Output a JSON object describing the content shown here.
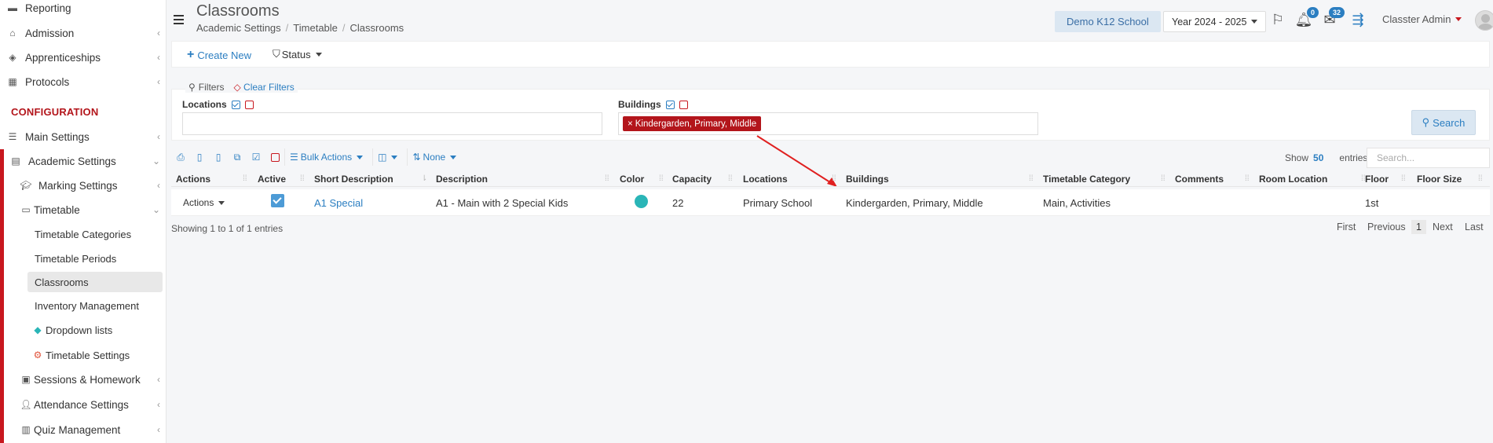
{
  "sidebar": {
    "items": [
      {
        "label": "Reporting",
        "icon": "reporting-icon"
      },
      {
        "label": "Admission",
        "icon": "institution-icon"
      },
      {
        "label": "Apprenticeships",
        "icon": "cube-icon"
      },
      {
        "label": "Protocols",
        "icon": "protocols-icon"
      }
    ],
    "section_label": "CONFIGURATION",
    "config_items": [
      {
        "label": "Main Settings"
      },
      {
        "label": "Academic Settings"
      },
      {
        "label": "Marking Settings"
      },
      {
        "label": "Timetable"
      },
      {
        "label": "Timetable Categories"
      },
      {
        "label": "Timetable Periods"
      },
      {
        "label": "Classrooms"
      },
      {
        "label": "Inventory Management"
      },
      {
        "label": "Dropdown lists"
      },
      {
        "label": "Timetable Settings"
      },
      {
        "label": "Sessions & Homework"
      },
      {
        "label": "Attendance Settings"
      },
      {
        "label": "Quiz Management"
      }
    ]
  },
  "header": {
    "title": "Classrooms",
    "breadcrumb": [
      "Academic Settings",
      "Timetable",
      "Classrooms"
    ],
    "school": "Demo K12 School",
    "year": "Year 2024 - 2025",
    "notifications_count": "0",
    "messages_count": "32",
    "user": "Classter Admin"
  },
  "toolbar": {
    "create_label": "Create New",
    "status_label": "Status"
  },
  "filters": {
    "legend": "Filters",
    "clear_label": "Clear Filters",
    "locations_label": "Locations",
    "buildings_label": "Buildings",
    "buildings_chip": "Kindergarden, Primary, Middle",
    "search_label": "Search"
  },
  "table_tools": {
    "bulk_actions": "Bulk Actions",
    "none_label": "None",
    "show_label": "Show",
    "show_value": "50",
    "entries_label": "entries",
    "search_placeholder": "Search..."
  },
  "table": {
    "columns": [
      "Actions",
      "Active",
      "Short Description",
      "Description",
      "Color",
      "Capacity",
      "Locations",
      "Buildings",
      "Timetable Category",
      "Comments",
      "Room Location",
      "Floor",
      "Floor Size"
    ],
    "rows": [
      {
        "actions": "Actions",
        "active": true,
        "short_description": "A1 Special",
        "description": "A1 - Main with 2 Special Kids",
        "color": "#2ab5b7",
        "capacity": "22",
        "locations": "Primary School",
        "buildings": "Kindergarden, Primary, Middle",
        "timetable_category": "Main, Activities",
        "comments": "",
        "room_location": "",
        "floor": "1st",
        "floor_size": ""
      }
    ],
    "info": "Showing 1 to 1 of 1 entries",
    "pager": [
      "First",
      "Previous",
      "1",
      "Next",
      "Last"
    ]
  },
  "colors": {
    "accent": "#2b7ec1",
    "brand_red": "#c8171e",
    "chip_red": "#b3151b"
  }
}
